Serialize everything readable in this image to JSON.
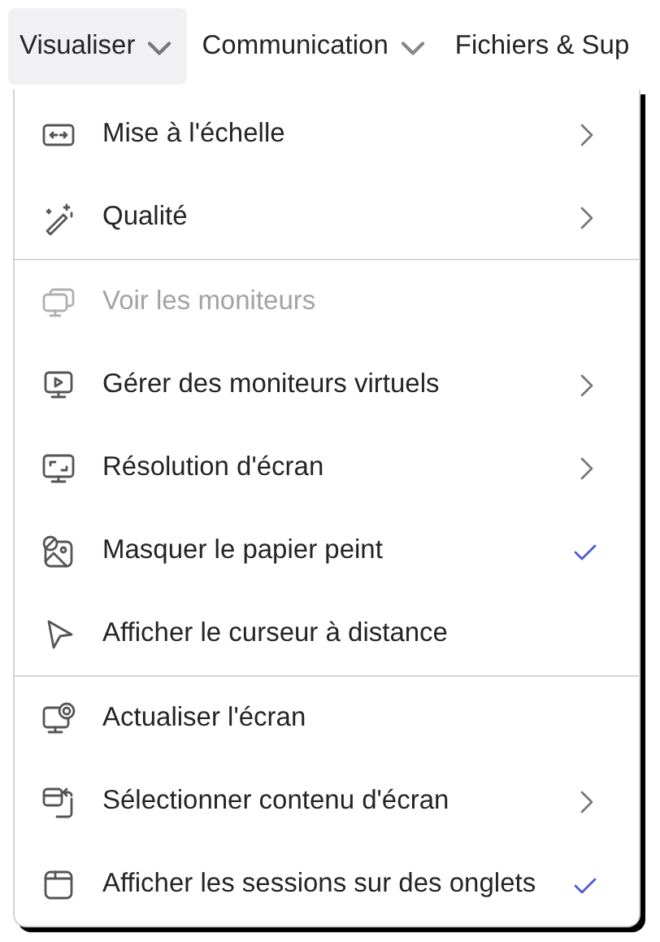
{
  "menubar": [
    {
      "label": "Visualiser",
      "selected": true,
      "dropdown": true
    },
    {
      "label": "Communication",
      "selected": false,
      "dropdown": true
    },
    {
      "label": "Fichiers & Sup",
      "selected": false,
      "dropdown": false
    }
  ],
  "menu": {
    "sections": [
      {
        "items": [
          {
            "label": "Mise à l'échelle",
            "disabled": false,
            "submenu": true,
            "checked": false
          },
          {
            "label": "Qualité",
            "disabled": false,
            "submenu": true,
            "checked": false
          }
        ]
      },
      {
        "items": [
          {
            "label": "Voir les moniteurs",
            "disabled": true,
            "submenu": false,
            "checked": false
          },
          {
            "label": "Gérer des moniteurs virtuels",
            "disabled": false,
            "submenu": true,
            "checked": false
          },
          {
            "label": "Résolution d'écran",
            "disabled": false,
            "submenu": true,
            "checked": false
          },
          {
            "label": "Masquer le papier peint",
            "disabled": false,
            "submenu": false,
            "checked": true
          },
          {
            "label": "Afficher le curseur à distance",
            "disabled": false,
            "submenu": false,
            "checked": false
          }
        ]
      },
      {
        "items": [
          {
            "label": "Actualiser l'écran",
            "disabled": false,
            "submenu": false,
            "checked": false
          },
          {
            "label": "Sélectionner contenu d'écran",
            "disabled": false,
            "submenu": true,
            "checked": false
          },
          {
            "label": "Afficher les sessions sur des onglets",
            "disabled": false,
            "submenu": false,
            "checked": true
          }
        ]
      }
    ]
  }
}
